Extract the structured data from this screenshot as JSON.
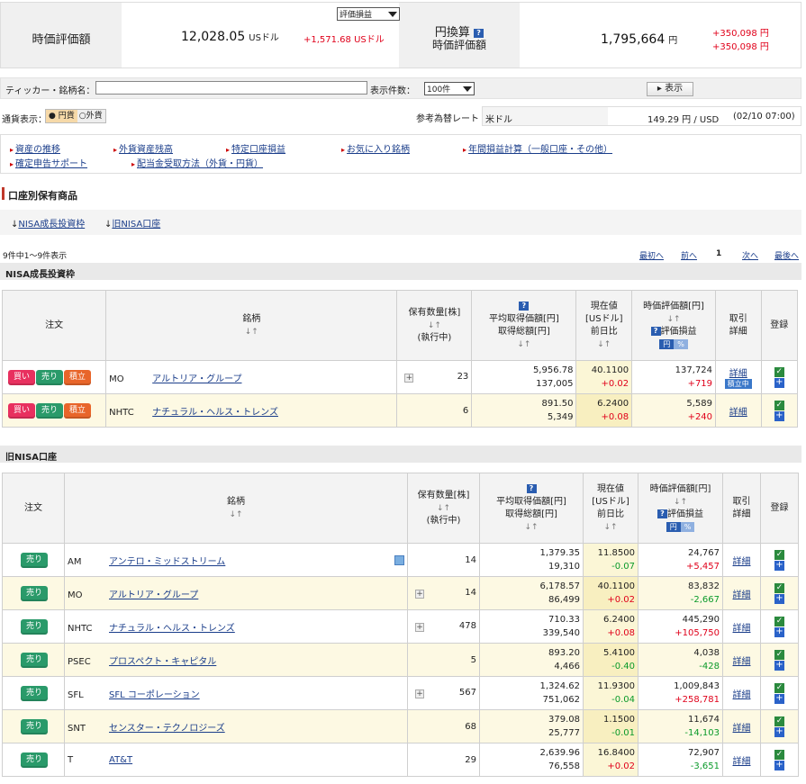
{
  "summary": {
    "market_value_label": "時価評価額",
    "market_value_usd": "12,028.05",
    "usd_unit": "USドル",
    "usd_change": "+1,571.68 USドル",
    "view_select": "評価損益",
    "yen_conv_label": "円換算",
    "yen_value_label": "時価評価額",
    "market_value_jpy": "1,795,664",
    "jpy_unit": "円",
    "jpy_change_1": "+350,098 円",
    "jpy_change_2": "+350,098 円"
  },
  "filter": {
    "ticker_label": "ティッカー・銘柄名：",
    "ticker_value": "",
    "count_label": "表示件数：",
    "count_value": "100件",
    "show_button": "表示",
    "currency_label": "通貨表示：",
    "jpy_option": "円貨",
    "fx_option": "外貨",
    "rate_label": "参考為替レート",
    "rate_currency": "米ドル",
    "rate_value": "149.29 円 / USD",
    "rate_time": "(02/10 07:00)"
  },
  "links": [
    {
      "label": "資産の推移"
    },
    {
      "label": "外貨資産残高"
    },
    {
      "label": "特定口座損益"
    },
    {
      "label": "お気に入り銘柄"
    },
    {
      "label": "年間損益計算（一般口座・その他）"
    },
    {
      "label": "確定申告サポート"
    },
    {
      "label": "配当金受取方法（外貨・円貨）"
    }
  ],
  "holdings_title": "口座別保有商品",
  "jump_links": {
    "nisa_growth": "NISA成長投資枠",
    "old_nisa": "旧NISA口座"
  },
  "pager": {
    "count_text": "9件中1〜9件表示",
    "first": "最初へ",
    "prev": "前へ",
    "page": "1",
    "next": "次へ",
    "last": "最後へ"
  },
  "headers": {
    "order": "注文",
    "name": "銘柄",
    "qty": "保有数量[株]",
    "qty2": "(執行中)",
    "avg": "平均取得価額[円]",
    "cost": "取得総額[円]",
    "price": "現在値",
    "price_unit": "[USドル]",
    "change": "前日比",
    "mv": "時価評価額[円]",
    "pl": "評価損益",
    "yen": "円",
    "pct": "%",
    "trade": "取引",
    "detail_h": "詳細",
    "reg": "登録",
    "sort": "↓↑"
  },
  "buttons": {
    "buy": "買い",
    "sell": "売り",
    "accum": "積立",
    "detail": "詳細",
    "accum_tag": "積立中"
  },
  "nisa_growth": {
    "title": "NISA成長投資枠",
    "rows": [
      {
        "ticker": "MO",
        "name": "アルトリア・グループ",
        "qty": "23",
        "avg": "5,956.78",
        "cost": "137,005",
        "price": "40.1100",
        "change": "+0.02",
        "change_color": "red",
        "mv": "137,724",
        "pl": "+719",
        "pl_color": "red"
      },
      {
        "ticker": "NHTC",
        "name": "ナチュラル・ヘルス・トレンズ",
        "qty": "6",
        "avg": "891.50",
        "cost": "5,349",
        "price": "6.2400",
        "change": "+0.08",
        "change_color": "red",
        "mv": "5,589",
        "pl": "+240",
        "pl_color": "red"
      }
    ]
  },
  "old_nisa": {
    "title": "旧NISA口座",
    "rows": [
      {
        "ticker": "AM",
        "name": "アンテロ・ミッドストリーム",
        "qty": "14",
        "avg": "1,379.35",
        "cost": "19,310",
        "price": "11.8500",
        "change": "-0.07",
        "change_color": "green",
        "mv": "24,767",
        "pl": "+5,457",
        "pl_color": "red"
      },
      {
        "ticker": "MO",
        "name": "アルトリア・グループ",
        "qty": "14",
        "avg": "6,178.57",
        "cost": "86,499",
        "price": "40.1100",
        "change": "+0.02",
        "change_color": "red",
        "mv": "83,832",
        "pl": "-2,667",
        "pl_color": "green"
      },
      {
        "ticker": "NHTC",
        "name": "ナチュラル・ヘルス・トレンズ",
        "qty": "478",
        "avg": "710.33",
        "cost": "339,540",
        "price": "6.2400",
        "change": "+0.08",
        "change_color": "red",
        "mv": "445,290",
        "pl": "+105,750",
        "pl_color": "red"
      },
      {
        "ticker": "PSEC",
        "name": "プロスペクト・キャピタル",
        "qty": "5",
        "avg": "893.20",
        "cost": "4,466",
        "price": "5.4100",
        "change": "-0.40",
        "change_color": "green",
        "mv": "4,038",
        "pl": "-428",
        "pl_color": "green"
      },
      {
        "ticker": "SFL",
        "name": "SFL コーポレーション",
        "qty": "567",
        "avg": "1,324.62",
        "cost": "751,062",
        "price": "11.9300",
        "change": "-0.04",
        "change_color": "green",
        "mv": "1,009,843",
        "pl": "+258,781",
        "pl_color": "red"
      },
      {
        "ticker": "SNT",
        "name": "センスター・テクノロジーズ",
        "qty": "68",
        "avg": "379.08",
        "cost": "25,777",
        "price": "1.1500",
        "change": "-0.01",
        "change_color": "green",
        "mv": "11,674",
        "pl": "-14,103",
        "pl_color": "green"
      },
      {
        "ticker": "T",
        "name": "AT&T",
        "qty": "29",
        "avg": "2,639.96",
        "cost": "76,558",
        "price": "16.8400",
        "change": "+0.02",
        "change_color": "red",
        "mv": "72,907",
        "pl": "-3,651",
        "pl_color": "green"
      }
    ]
  },
  "colors": {
    "buy": "#e8305f",
    "sell": "#2a9a6a",
    "accum": "#e8652a",
    "up": "#e0001a",
    "down": "#0a9a2a"
  }
}
